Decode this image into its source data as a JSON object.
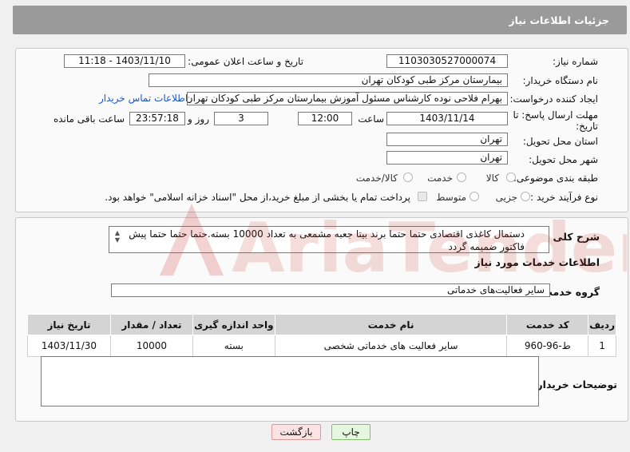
{
  "header": {
    "title": "جزئیات اطلاعات نیاز"
  },
  "form": {
    "need_number": {
      "label": "شماره نیاز:",
      "value": "1103030527000074"
    },
    "announce_datetime": {
      "label": "تاریخ و ساعت اعلان عمومی:",
      "value": "1403/11/10 - 11:18"
    },
    "buyer_org": {
      "label": "نام دستگاه خریدار:",
      "value": "بیمارستان مرکز طبی کودکان تهران"
    },
    "requester": {
      "label": "ایجاد کننده درخواست:",
      "value": "بهرام فلاحی نوده کارشناس مسئول آموزش بیمارستان مرکز طبی کودکان تهران",
      "contact_link": "اطلاعات تماس خریدار"
    },
    "deadline": {
      "label": "مهلت ارسال پاسخ: تا تاریخ:",
      "date": "1403/11/14",
      "time_label": "ساعت",
      "time": "12:00",
      "days": "3",
      "days_label": "روز و",
      "remaining": "23:57:18",
      "remaining_label": "ساعت باقی مانده"
    },
    "province": {
      "label": "استان محل تحویل:",
      "value": "تهران"
    },
    "city": {
      "label": "شهر محل تحویل:",
      "value": "تهران"
    },
    "category": {
      "label": "طبقه بندی موضوعی:",
      "options": [
        "کالا",
        "خدمت",
        "کالا/خدمت"
      ]
    },
    "process": {
      "label": "نوع فرآیند خرید :",
      "options": [
        "جزیی",
        "متوسط"
      ],
      "payment_text": "پرداخت تمام یا بخشی از مبلغ خرید،از محل \"اسناد خزانه اسلامی\" خواهد بود."
    }
  },
  "summary": {
    "label": "شرح کلی نیاز:",
    "text": "دستمال کاغذی اقتصادی حتما حتما برند بیتا جعبه مشمعی به تعداد 10000 بسته.حتما حتما حتما پیش فاکتور ضمیمه گردد"
  },
  "services": {
    "section_title": "اطلاعات خدمات مورد نیاز",
    "group_label": "گروه خدمت:",
    "group_value": "سایر فعالیت‌های خدماتی",
    "columns": [
      "ردیف",
      "کد خدمت",
      "نام خدمت",
      "واحد اندازه گیری",
      "تعداد / مقدار",
      "تاریخ نیاز"
    ],
    "rows": [
      [
        "1",
        "ط-96-960",
        "سایر فعالیت های خدماتی شخصی",
        "بسته",
        "10000",
        "1403/11/30"
      ]
    ]
  },
  "buyer_notes": {
    "label": "توضیحات خریدار:",
    "value": ""
  },
  "buttons": {
    "print": "چاپ",
    "back": "بازگشت"
  },
  "watermark": {
    "text": "AriaTender.net"
  },
  "colors": {
    "header_bg": "#9a9a9a",
    "link": "#1a56c8",
    "print_btn": "#e6f7e0",
    "back_btn": "#fbe3e3"
  }
}
